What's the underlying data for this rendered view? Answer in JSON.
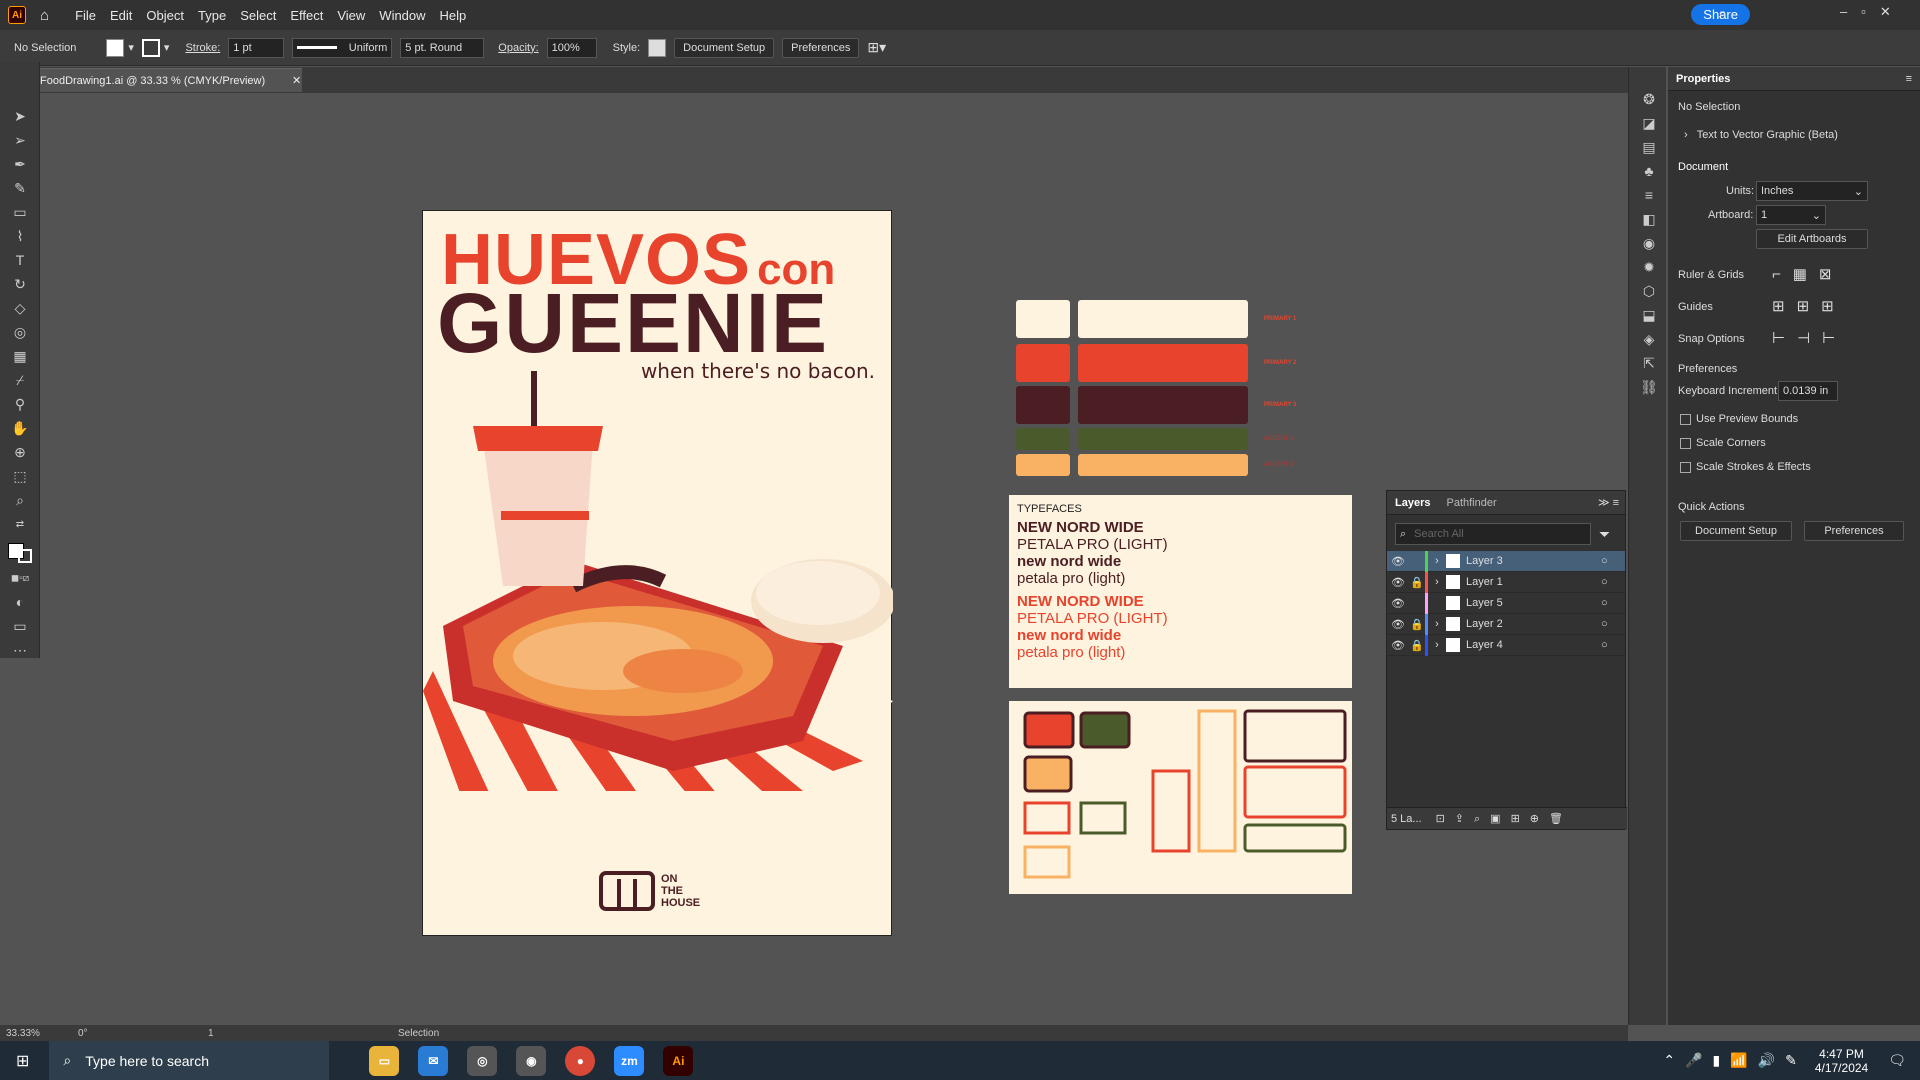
{
  "app": {
    "logo": "Ai",
    "menu": [
      "File",
      "Edit",
      "Object",
      "Type",
      "Select",
      "Effect",
      "View",
      "Window",
      "Help"
    ],
    "share": "Share"
  },
  "control": {
    "selection": "No Selection",
    "stroke_label": "Stroke:",
    "stroke_value": "1 pt",
    "stroke_type": "Uniform",
    "brush": "5 pt. Round",
    "opacity_label": "Opacity:",
    "opacity_value": "100%",
    "style_label": "Style:",
    "doc_setup": "Document Setup",
    "prefs": "Preferences"
  },
  "doc": {
    "tab": "FoodDrawing1.ai @ 33.33 % (CMYK/Preview)"
  },
  "artboard": {
    "line1a": "HUEVOS",
    "line1b": "con",
    "line2": "GUEENIE",
    "tagline": "when there's no bacon.",
    "logo_l1": "ON",
    "logo_l2": "THE",
    "logo_l3": "HOUSE"
  },
  "palette": {
    "labels": [
      "PRIMARY 1",
      "PRIMARY 2",
      "PRIMARY 3",
      "ACCENT 1",
      "ACCENT 2"
    ],
    "colors": [
      "#fdf3de",
      "#e8432d",
      "#4a1e22",
      "#4b5a2a",
      "#f9b264"
    ]
  },
  "typefaces": {
    "title": "TYPEFACES",
    "dark": [
      "NEW NORD WIDE",
      "PETALA PRO (LIGHT)",
      "new nord wide",
      "petala pro (light)"
    ],
    "red": [
      "NEW NORD WIDE",
      "PETALA PRO (LIGHT)",
      "new nord wide",
      "petala pro (light)"
    ]
  },
  "properties": {
    "tab": "Properties",
    "selection": "No Selection",
    "text_to_vector": "Text to Vector Graphic (Beta)",
    "document": "Document",
    "units_label": "Units:",
    "units": "Inches",
    "artboard_label": "Artboard:",
    "artboard_value": "1",
    "edit_artboards": "Edit Artboards",
    "ruler": "Ruler & Grids",
    "guides": "Guides",
    "snap": "Snap Options",
    "preferences": "Preferences",
    "kb_label": "Keyboard Increment:",
    "kb_value": "0.0139 in",
    "preview_bounds": "Use Preview Bounds",
    "scale_corners": "Scale Corners",
    "scale_strokes": "Scale Strokes & Effects",
    "quick_actions": "Quick Actions",
    "doc_setup": "Document Setup",
    "prefs": "Preferences"
  },
  "layers": {
    "tab1": "Layers",
    "tab2": "Pathfinder",
    "search": "Search All",
    "count": "5 La...",
    "rows": [
      {
        "name": "Layer 3",
        "color": "#4fd24f"
      },
      {
        "name": "Layer 1",
        "color": "#ff5050"
      },
      {
        "name": "Layer 5",
        "color": "#ffa0ff"
      },
      {
        "name": "Layer 2",
        "color": "#4f8cff"
      },
      {
        "name": "Layer 4",
        "color": "#2a50ff"
      }
    ]
  },
  "status": {
    "zoom": "33.33%",
    "angle": "0°",
    "artboard": "1",
    "tool": "Selection"
  },
  "taskbar": {
    "search": "Type here to search",
    "time": "4:47 PM",
    "date": "4/17/2024"
  }
}
